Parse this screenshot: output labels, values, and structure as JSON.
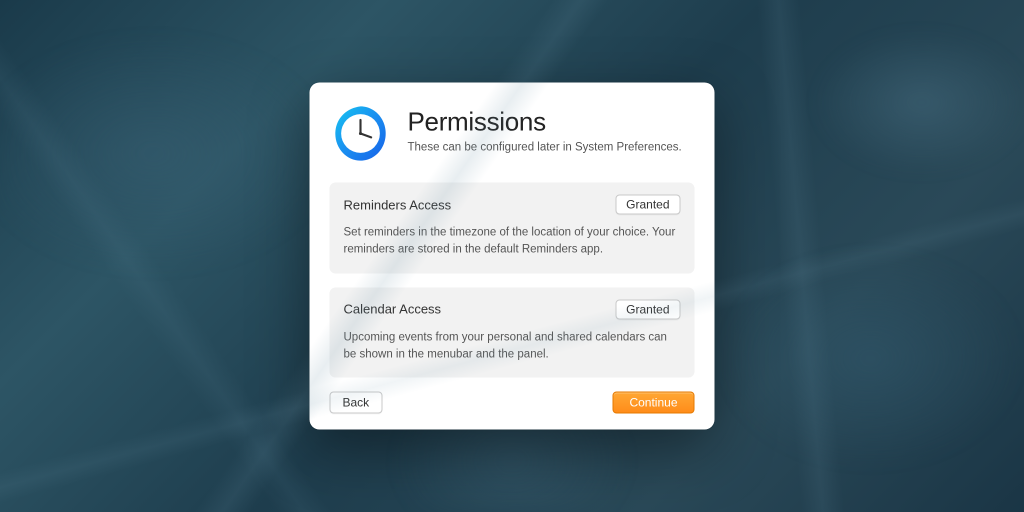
{
  "header": {
    "title": "Permissions",
    "subtitle": "These can be configured later in System Preferences."
  },
  "cards": [
    {
      "title": "Reminders Access",
      "status": "Granted",
      "description": "Set reminders in the timezone of the location of your choice. Your reminders are stored in the default Reminders app."
    },
    {
      "title": "Calendar Access",
      "status": "Granted",
      "description": "Upcoming events from your personal and shared calendars can be shown in the menubar and the panel."
    }
  ],
  "footer": {
    "back": "Back",
    "continue": "Continue"
  }
}
